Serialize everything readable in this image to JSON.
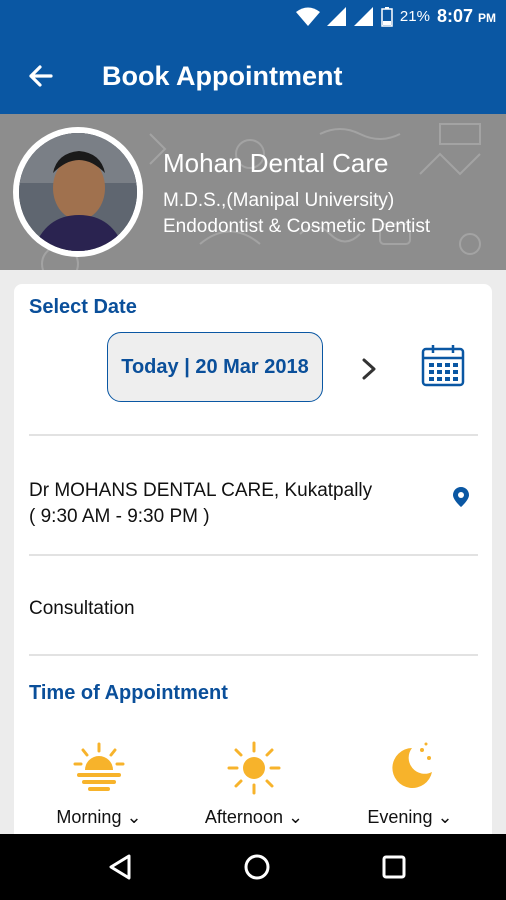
{
  "status": {
    "battery": "21%",
    "time": "8:07",
    "ampm": "PM"
  },
  "header": {
    "title": "Book Appointment"
  },
  "doctor": {
    "clinic_name": "Mohan Dental Care",
    "qualification": "M.D.S.,(Manipal University)",
    "specialty": "Endodontist & Cosmetic Dentist"
  },
  "select_date": {
    "title": "Select Date",
    "date_label": "Today | 20 Mar 2018"
  },
  "location": {
    "name": "Dr MOHANS DENTAL CARE, Kukatpally",
    "hours": "( 9:30 AM - 9:30 PM )"
  },
  "service": {
    "label": "Consultation"
  },
  "time_of_appointment": {
    "title": "Time of Appointment",
    "slots": [
      {
        "label": "Morning",
        "icon": "sunrise-icon"
      },
      {
        "label": "Afternoon",
        "icon": "sun-icon"
      },
      {
        "label": "Evening",
        "icon": "moon-icon"
      }
    ]
  },
  "colors": {
    "primary": "#0a57a3",
    "accent_icon": "#f7b32b",
    "title_text": "#0a4f9a"
  }
}
